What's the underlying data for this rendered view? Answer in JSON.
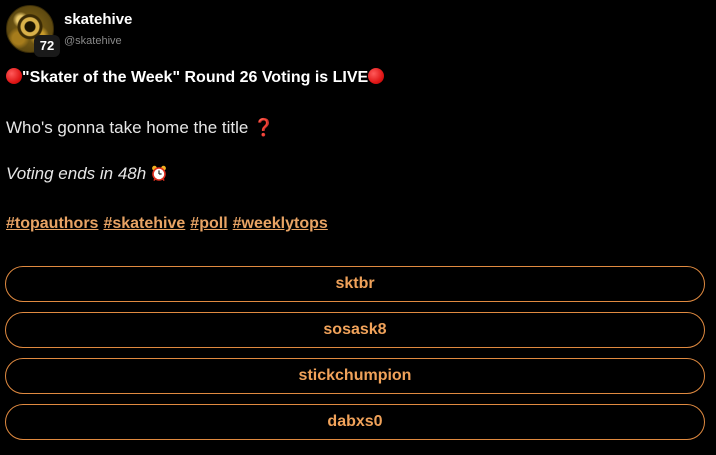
{
  "author": {
    "display_name": "skatehive",
    "handle": "@skatehive",
    "level": "72",
    "avatar_icon": "skatehive-avatar"
  },
  "post": {
    "title": "\"Skater of the Week\" Round 26 Voting is LIVE",
    "title_icon": "red-circle-emoji",
    "line1": "Who's gonna take home the title ",
    "line1_emoji": "❓",
    "line2": "Voting ends in 48h ",
    "line2_icon": "alarm-clock-emoji",
    "hashtags": [
      "#topauthors",
      "#skatehive",
      "#poll",
      "#weeklytops"
    ]
  },
  "poll": {
    "options": [
      "sktbr",
      "sosask8",
      "stickchumpion",
      "dabxs0"
    ]
  },
  "colors": {
    "background": "#000000",
    "accent": "#e8a364",
    "poll_border": "#e08a40",
    "red_emoji": "#e01818"
  }
}
